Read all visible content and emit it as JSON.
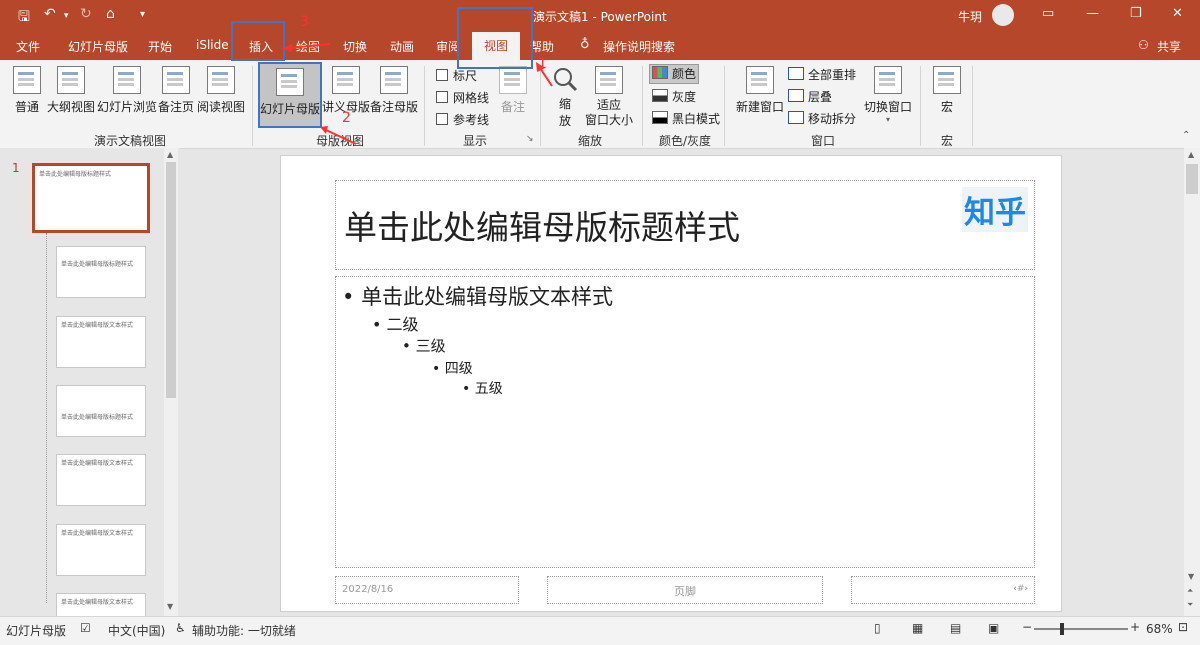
{
  "window": {
    "doc_title": "演示文稿1  -  PowerPoint",
    "user": "牛玥",
    "share": "共享"
  },
  "tabs": [
    "文件",
    "幻灯片母版",
    "开始",
    "iSlide",
    "插入",
    "绘图",
    "切换",
    "动画",
    "审阅",
    "视图",
    "帮助",
    "操作说明搜索"
  ],
  "active_tab": "视图",
  "ribbon": {
    "presentation_views": {
      "label": "演示文稿视图",
      "buttons": [
        "普通",
        "大纲视图",
        "幻灯片浏览",
        "备注页",
        "阅读视图"
      ]
    },
    "master_views": {
      "label": "母版视图",
      "buttons": [
        "幻灯片母版",
        "讲义母版",
        "备注母版"
      ]
    },
    "show": {
      "label": "显示",
      "checks": [
        "标尺",
        "网格线",
        "参考线"
      ],
      "notes": "备注"
    },
    "zoom": {
      "label": "缩放",
      "zoom_btn": [
        "缩",
        "放"
      ],
      "fit_btn": [
        "适应",
        "窗口大小"
      ]
    },
    "color": {
      "label": "颜色/灰度",
      "items": [
        "颜色",
        "灰度",
        "黑白模式"
      ]
    },
    "window": {
      "label": "窗口",
      "new_window": "新建窗口",
      "items": [
        "全部重排",
        "层叠",
        "移动拆分"
      ],
      "switch": "切换窗口"
    },
    "macros": {
      "label": "宏",
      "button": "宏"
    }
  },
  "thumbnails": {
    "index_label": "1",
    "t1_title": "单击此处编辑母版标题样式",
    "t2_title": "单击此处编辑母版标题样式",
    "t3_title": "单击此处编辑母版文本样式",
    "t4_title": "单击此处编辑母版标题样式",
    "t5_title": "单击此处编辑母版文本样式",
    "t6_title": "单击此处编辑母版文本样式",
    "t7_title": "单击此处编辑母版文本样式"
  },
  "slide": {
    "title": "单击此处编辑母版标题样式",
    "logo": "知乎",
    "bullets": [
      "单击此处编辑母版文本样式",
      "二级",
      "三级",
      "四级",
      "五级"
    ],
    "date": "2022/8/16",
    "footer": "页脚",
    "page_num": "‹#›"
  },
  "status": {
    "view_name": "幻灯片母版",
    "language": "中文(中国)",
    "accessibility": "辅助功能: 一切就绪",
    "zoom": "68%"
  },
  "annotations": [
    "1",
    "2",
    "3"
  ]
}
